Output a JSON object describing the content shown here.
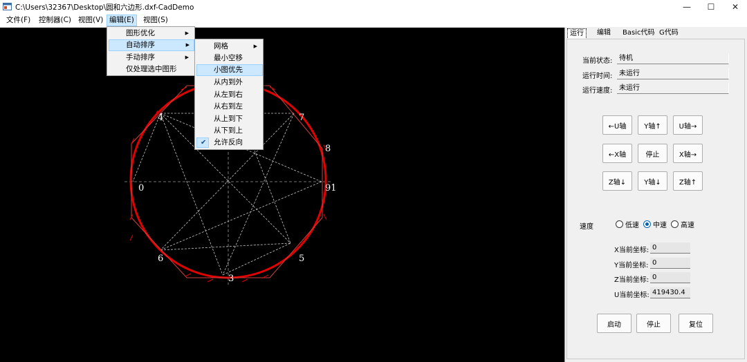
{
  "window": {
    "title": "C:\\Users\\32367\\Desktop\\圆和六边形.dxf-CadDemo",
    "minimize": "—",
    "maximize": "☐",
    "close": "✕"
  },
  "menubar": [
    "文件(F)",
    "控制器(C)",
    "视图(V)",
    "编辑(E)",
    "视图(S)"
  ],
  "edit_menu": {
    "items": [
      "图形优化",
      "自动排序",
      "手动排序",
      "仅处理选中图形"
    ]
  },
  "auto_sort_menu": {
    "items": [
      "网格",
      "最小空移",
      "小图优先",
      "从内到外",
      "从左到右",
      "从右到左",
      "从上到下",
      "从下到上",
      "允许反向"
    ],
    "highlighted": "小图优先",
    "checked": "允许反向"
  },
  "canvas": {
    "labels": [
      "4",
      "7",
      "8",
      "0",
      "91",
      "6",
      "5",
      "3"
    ],
    "colors": {
      "background": "#000000",
      "circle": "#e00000",
      "paths": "#c8c8c8"
    }
  },
  "tabs": [
    "运行",
    "编辑",
    "Basic代码",
    "G代码"
  ],
  "status": {
    "state_label": "当前状态:",
    "state_value": "待机",
    "time_label": "运行时间:",
    "time_value": "未运行",
    "speed_label": "运行速度:",
    "speed_value": "未运行"
  },
  "jog": {
    "u_left": "←U轴",
    "y_up": "Y轴↑",
    "u_right": "U轴→",
    "x_left": "←X轴",
    "stop": "停止",
    "x_right": "X轴→",
    "z_down": "Z轴↓",
    "y_down": "Y轴↓",
    "z_up": "Z轴↑"
  },
  "speed": {
    "label": "速度",
    "options": [
      "低速",
      "中速",
      "高速"
    ],
    "selected": "中速"
  },
  "coords": {
    "x_label": "X当前坐标:",
    "x_value": "0",
    "y_label": "Y当前坐标:",
    "y_value": "0",
    "z_label": "Z当前坐标:",
    "z_value": "0",
    "u_label": "U当前坐标:",
    "u_value": "419430.4"
  },
  "actions": {
    "start": "启动",
    "stop": "停止",
    "reset": "复位"
  }
}
